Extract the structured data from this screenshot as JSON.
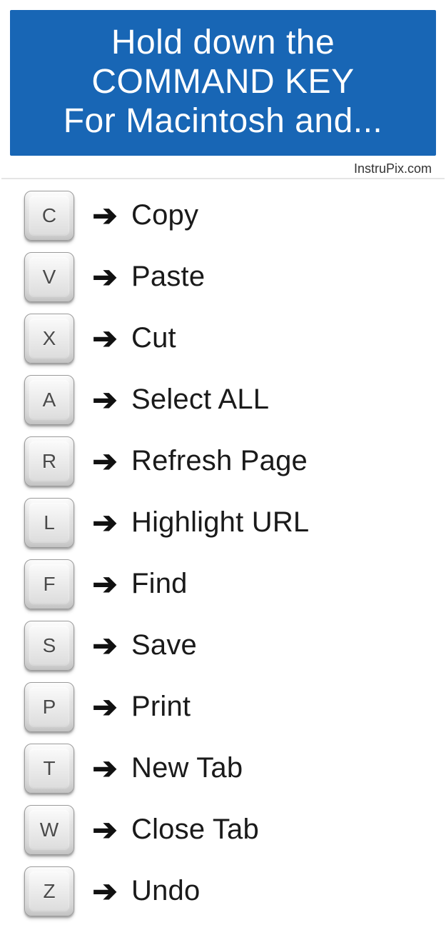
{
  "header": {
    "line1": "Hold down the",
    "line2": "COMMAND KEY",
    "line3": "For Macintosh and..."
  },
  "attribution": "InstruPix.com",
  "shortcuts": [
    {
      "key": "C",
      "action": "Copy"
    },
    {
      "key": "V",
      "action": "Paste"
    },
    {
      "key": "X",
      "action": "Cut"
    },
    {
      "key": "A",
      "action": "Select  ALL"
    },
    {
      "key": "R",
      "action": "Refresh Page"
    },
    {
      "key": "L",
      "action": "Highlight URL"
    },
    {
      "key": "F",
      "action": "Find"
    },
    {
      "key": "S",
      "action": "Save"
    },
    {
      "key": "P",
      "action": "Print"
    },
    {
      "key": "T",
      "action": "New Tab"
    },
    {
      "key": "W",
      "action": "Close Tab"
    },
    {
      "key": "Z",
      "action": "Undo"
    }
  ],
  "arrow_glyph": "➔"
}
